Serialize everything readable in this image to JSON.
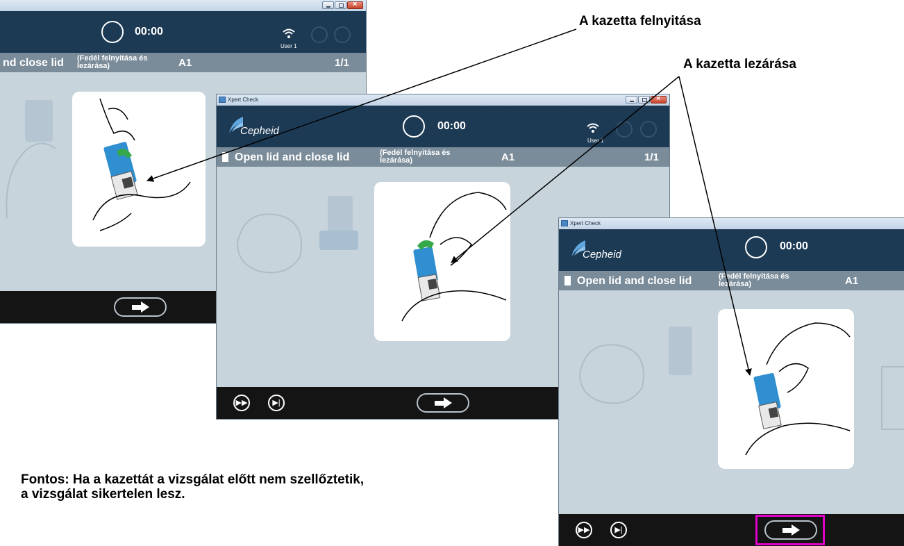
{
  "annotations": {
    "open_cartridge": "A kazetta felnyitása",
    "close_cartridge": "A kazetta lezárása",
    "note_line1": "Fontos: Ha a kazettát a vizsgálat előtt nem szellőztetik,",
    "note_line2": "a vizsgálat sikertelen lesz."
  },
  "app": {
    "window_title": "Xpert Check",
    "logo_text": "Cepheid",
    "timer": "00:00",
    "user": "User 1",
    "step_title": "Open lid and close lid",
    "step_subtitle_line1": "(Fedél felnyitása és",
    "step_subtitle_line2": "lezárása)",
    "step_title_cropped": "nd close lid",
    "position": "A1",
    "step_count": "1/1"
  },
  "colors": {
    "header": "#1d3a54",
    "stepbar": "#7a8b99",
    "content_bg": "#c7d4dc",
    "footer": "#141414",
    "highlight": "#e100c8",
    "cartridge_blue": "#2f8fd0",
    "cartridge_lid_green": "#36a84a"
  },
  "icons": [
    "wifi-icon",
    "home-icon",
    "mute-icon",
    "timer-circle-icon",
    "next-arrow-icon",
    "fast-forward-icon",
    "skip-to-end-icon",
    "app-window-icon",
    "minimize-icon",
    "maximize-icon",
    "close-icon"
  ]
}
